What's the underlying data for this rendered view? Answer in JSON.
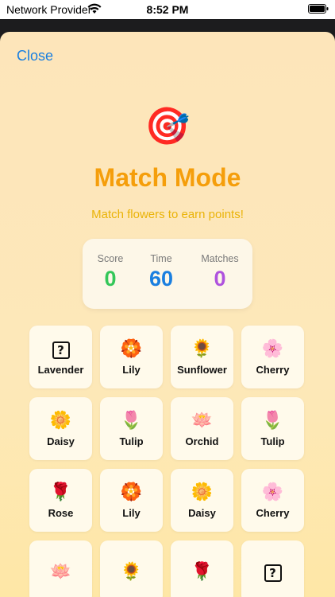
{
  "status_bar": {
    "carrier": "Network Provider",
    "time": "8:52 PM"
  },
  "sheet": {
    "close_label": "Close",
    "hero_icon": "🎯",
    "title": "Match Mode",
    "subtitle": "Match flowers to earn points!"
  },
  "stats": [
    {
      "label": "Score",
      "value": "0",
      "color": "#34c759"
    },
    {
      "label": "Time",
      "value": "60",
      "color": "#1a7fe0"
    },
    {
      "label": "Matches",
      "value": "0",
      "color": "#af52de"
    }
  ],
  "tiles": [
    {
      "label": "Lavender",
      "icon": "question-box-icon",
      "glyph": "?"
    },
    {
      "label": "Lily",
      "icon": "lily-icon",
      "glyph": "🏵️"
    },
    {
      "label": "Sunflower",
      "icon": "sunflower-icon",
      "glyph": "🌻"
    },
    {
      "label": "Cherry",
      "icon": "cherry-blossom-icon",
      "glyph": "🌸"
    },
    {
      "label": "Daisy",
      "icon": "daisy-icon",
      "glyph": "🌼"
    },
    {
      "label": "Tulip",
      "icon": "tulip-icon",
      "glyph": "🌷"
    },
    {
      "label": "Orchid",
      "icon": "lotus-icon",
      "glyph": "🪷"
    },
    {
      "label": "Tulip",
      "icon": "tulip-icon",
      "glyph": "🌷"
    },
    {
      "label": "Rose",
      "icon": "rose-icon",
      "glyph": "🌹"
    },
    {
      "label": "Lily",
      "icon": "lily-icon",
      "glyph": "🏵️"
    },
    {
      "label": "Daisy",
      "icon": "daisy-icon",
      "glyph": "🌼"
    },
    {
      "label": "Cherry",
      "icon": "cherry-blossom-icon",
      "glyph": "🌸"
    },
    {
      "label": "",
      "icon": "lotus-icon",
      "glyph": "🪷"
    },
    {
      "label": "",
      "icon": "sunflower-icon",
      "glyph": "🌻"
    },
    {
      "label": "",
      "icon": "rose-icon",
      "glyph": "🌹"
    },
    {
      "label": "",
      "icon": "question-box-icon",
      "glyph": "?"
    }
  ]
}
